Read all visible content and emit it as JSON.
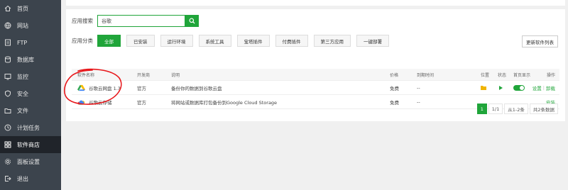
{
  "sidebar": {
    "items": [
      {
        "label": "首页",
        "icon": "home-icon"
      },
      {
        "label": "网站",
        "icon": "globe-icon"
      },
      {
        "label": "FTP",
        "icon": "ftp-icon"
      },
      {
        "label": "数据库",
        "icon": "database-icon"
      },
      {
        "label": "监控",
        "icon": "monitor-icon"
      },
      {
        "label": "安全",
        "icon": "shield-icon"
      },
      {
        "label": "文件",
        "icon": "folder-icon"
      },
      {
        "label": "计划任务",
        "icon": "clock-icon"
      },
      {
        "label": "软件商店",
        "icon": "grid-icon",
        "active": true
      },
      {
        "label": "面板设置",
        "icon": "gear-icon"
      },
      {
        "label": "退出",
        "icon": "logout-icon"
      }
    ]
  },
  "search": {
    "label": "应用搜索",
    "value": "谷歌"
  },
  "categories": {
    "label": "应用分类",
    "items": [
      "全部",
      "已安装",
      "运行环境",
      "系统工具",
      "宝塔插件",
      "付费插件",
      "第三方应用",
      "一键部署"
    ],
    "active": "全部",
    "update_button": "更新软件列表"
  },
  "table": {
    "headers": {
      "name": "软件名称",
      "developer": "开发商",
      "description": "说明",
      "price": "价格",
      "expiry": "到期时间",
      "position": "位置",
      "status": "状态",
      "home": "首页显示",
      "action": "操作"
    },
    "rows": [
      {
        "name": "谷歌云网盘 1.3",
        "developer": "官方",
        "description": "备份你的数据到谷歌云盘",
        "price": "免费",
        "expiry": "--",
        "installed": true,
        "actions": [
          "设置",
          "卸载"
        ]
      },
      {
        "name": "谷歌云存储",
        "developer": "官方",
        "description": "将网站或数据库打包备份到Google Cloud Storage",
        "price": "免费",
        "expiry": "--",
        "installed": false,
        "actions": [
          "安装"
        ]
      }
    ]
  },
  "pagination": {
    "current": "1",
    "pages": "1/1",
    "range": "从1-2条",
    "total": "共2条数据"
  },
  "colors": {
    "accent": "#20a53a",
    "sidebar": "#3c444d",
    "annotation": "#e8171b"
  }
}
